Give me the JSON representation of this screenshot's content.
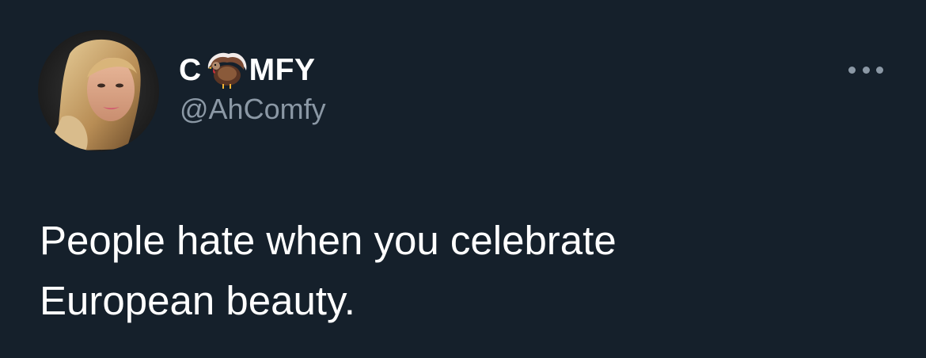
{
  "tweet": {
    "author": {
      "name_before": "C",
      "name_emoji": "turkey-emoji",
      "name_after": "MFY",
      "handle": "@AhComfy",
      "avatar": "profile-photo"
    },
    "text_line1": "People hate when you celebrate",
    "text_line2": "European beauty.",
    "more_icon": "ellipsis-icon"
  },
  "colors": {
    "background": "#15202b",
    "text": "#ffffff",
    "secondary_text": "#8b98a5"
  }
}
